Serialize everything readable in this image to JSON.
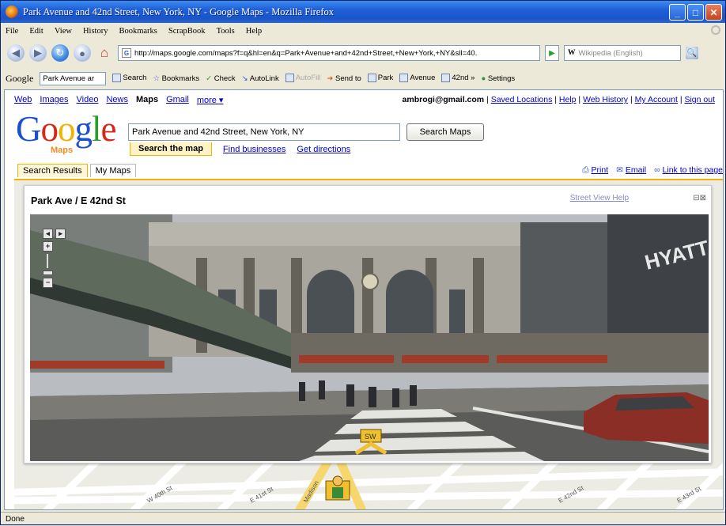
{
  "window": {
    "title": "Park Avenue and 42nd Street, New York, NY - Google Maps - Mozilla Firefox"
  },
  "menu": [
    "File",
    "Edit",
    "View",
    "History",
    "Bookmarks",
    "ScrapBook",
    "Tools",
    "Help"
  ],
  "nav": {
    "url": "http://maps.google.com/maps?f=q&hl=en&q=Park+Avenue+and+42nd+Street,+New+York,+NY&sll=40.",
    "search_engine": "W",
    "search_placeholder": "Wikipedia (English)"
  },
  "gtoolbar": {
    "logo": "Google",
    "search_value": "Park Avenue ar",
    "items": [
      "Search",
      "Bookmarks",
      "Check",
      "AutoLink",
      "AutoFill",
      "Send to",
      "Park",
      "Avenue",
      "42nd",
      "Settings"
    ]
  },
  "top_links": {
    "items": [
      "Web",
      "Images",
      "Video",
      "News",
      "Maps",
      "Gmail",
      "more ▾"
    ],
    "selected": "Maps",
    "email": "ambrogi@gmail.com",
    "right": [
      "Saved Locations",
      "Help",
      "Web History",
      "My Account",
      "Sign out"
    ]
  },
  "brand": {
    "maps": "Maps"
  },
  "search": {
    "query": "Park Avenue and 42nd Street, New York, NY",
    "button": "Search Maps"
  },
  "search_tabs": {
    "active": "Search the map",
    "links": [
      "Find businesses",
      "Get directions"
    ]
  },
  "panel_tabs": [
    "Search Results",
    "My Maps"
  ],
  "page_actions": [
    "Print",
    "Email",
    "Link to this page"
  ],
  "streetview": {
    "title": "Park Ave / E 42nd St",
    "help": "Street View Help",
    "sign": "HYATT",
    "compass": "SW"
  },
  "map_labels": [
    "W 40th St",
    "E 41st St",
    "Madison",
    "E 42nd St",
    "E 43rd St"
  ],
  "status": "Done",
  "colors": {
    "titlebar": "#1f5fd8",
    "gold": "#f0b400",
    "link": "#0000cc"
  }
}
